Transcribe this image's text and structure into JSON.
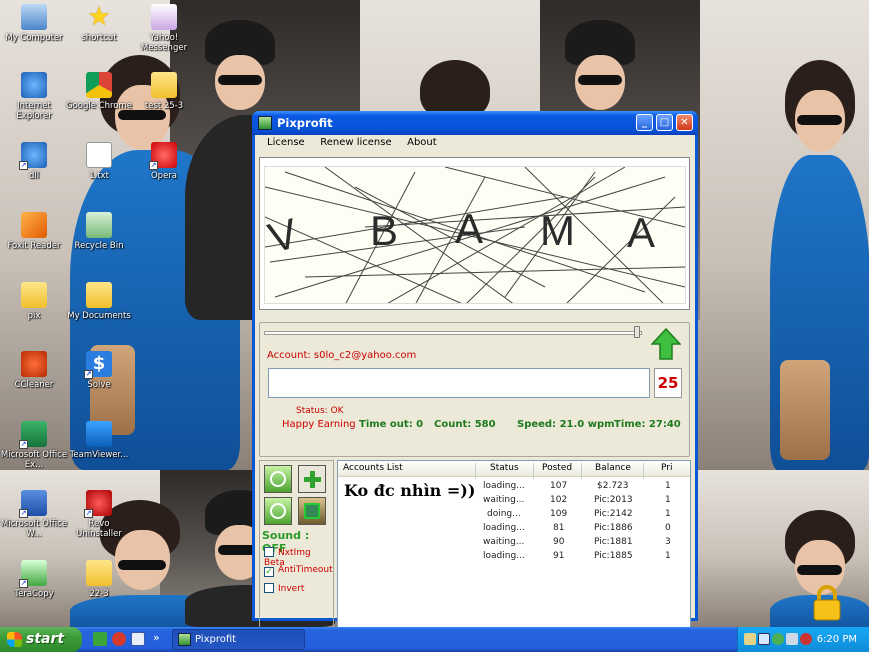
{
  "desktop": {
    "icons": [
      {
        "label": "My Computer",
        "icon": "my-computer-icon"
      },
      {
        "label": "shortcut",
        "icon": "star-icon"
      },
      {
        "label": "Yahoo! Messenger",
        "icon": "yahoo-messenger-icon"
      },
      {
        "label": "Internet Explorer",
        "icon": "internet-explorer-icon"
      },
      {
        "label": "Google Chrome",
        "icon": "chrome-icon"
      },
      {
        "label": "test 25-3",
        "icon": "folder-icon"
      },
      {
        "label": "dll",
        "icon": "dll-icon"
      },
      {
        "label": "1.txt",
        "icon": "text-file-icon"
      },
      {
        "label": "Opera",
        "icon": "opera-icon"
      },
      {
        "label": "Foxit Reader",
        "icon": "foxit-icon"
      },
      {
        "label": "Recycle Bin",
        "icon": "recycle-bin-icon"
      },
      {
        "label": "pix",
        "icon": "folder-icon"
      },
      {
        "label": "My Documents",
        "icon": "my-documents-icon"
      },
      {
        "label": "CCleaner",
        "icon": "ccleaner-icon"
      },
      {
        "label": "Solve",
        "icon": "solve-icon"
      },
      {
        "label": "Microsoft Office Ex...",
        "icon": "excel-icon"
      },
      {
        "label": "TeamViewer...",
        "icon": "teamviewer-icon"
      },
      {
        "label": "Microsoft Office W...",
        "icon": "word-icon"
      },
      {
        "label": "Revo Uninstaller",
        "icon": "revo-icon"
      },
      {
        "label": "TeraCopy",
        "icon": "teracopy-icon"
      },
      {
        "label": "22-3",
        "icon": "folder-icon"
      }
    ]
  },
  "window": {
    "title": "Pixprofit",
    "controls": {
      "minimize": "_",
      "maximize": "□",
      "close": "✕"
    },
    "menu": [
      "License",
      "Renew license",
      "About"
    ],
    "captcha_letters": [
      "V",
      "B",
      "A",
      "M",
      "A"
    ],
    "account_label": "Account: s0lo_c2@yahoo.com",
    "answer_value": "",
    "queue_count": "25",
    "status_text": "Status: OK",
    "stats": {
      "greeting": "Happy Earning",
      "timeout": "Time out: 0",
      "count": "Count: 580",
      "speed": "Speed: 21.0 wpm",
      "time": "Time: 27:40"
    },
    "sound_label": "Sound : OFF",
    "options": [
      {
        "label": "NxtImg Beta",
        "checked": false
      },
      {
        "label": "AntiTimeout",
        "checked": true
      },
      {
        "label": "Invert",
        "checked": false
      }
    ],
    "accounts": {
      "columns": [
        "Accounts List",
        "Status",
        "Posted",
        "Balance",
        "Pri"
      ],
      "overlay_text": "Ko đc nhìn =))",
      "rows": [
        {
          "status": "loading...",
          "posted": "107",
          "balance": "$2.723",
          "pri": "1"
        },
        {
          "status": "waiting...",
          "posted": "102",
          "balance": "Pic:2013",
          "pri": "1"
        },
        {
          "status": "doing...",
          "posted": "109",
          "balance": "Pic:2142",
          "pri": "1"
        },
        {
          "status": "loading...",
          "posted": "81",
          "balance": "Pic:1886",
          "pri": "0"
        },
        {
          "status": "waiting...",
          "posted": "90",
          "balance": "Pic:1881",
          "pri": "3"
        },
        {
          "status": "loading...",
          "posted": "91",
          "balance": "Pic:1885",
          "pri": "1"
        }
      ],
      "scroll_left": "◀",
      "scroll_right": "▶",
      "scroll_grip": "|||"
    }
  },
  "taskbar": {
    "start_label": "start",
    "quicklaunch_more": "»",
    "task_label": "Pixprofit",
    "clock": "6:20 PM"
  }
}
